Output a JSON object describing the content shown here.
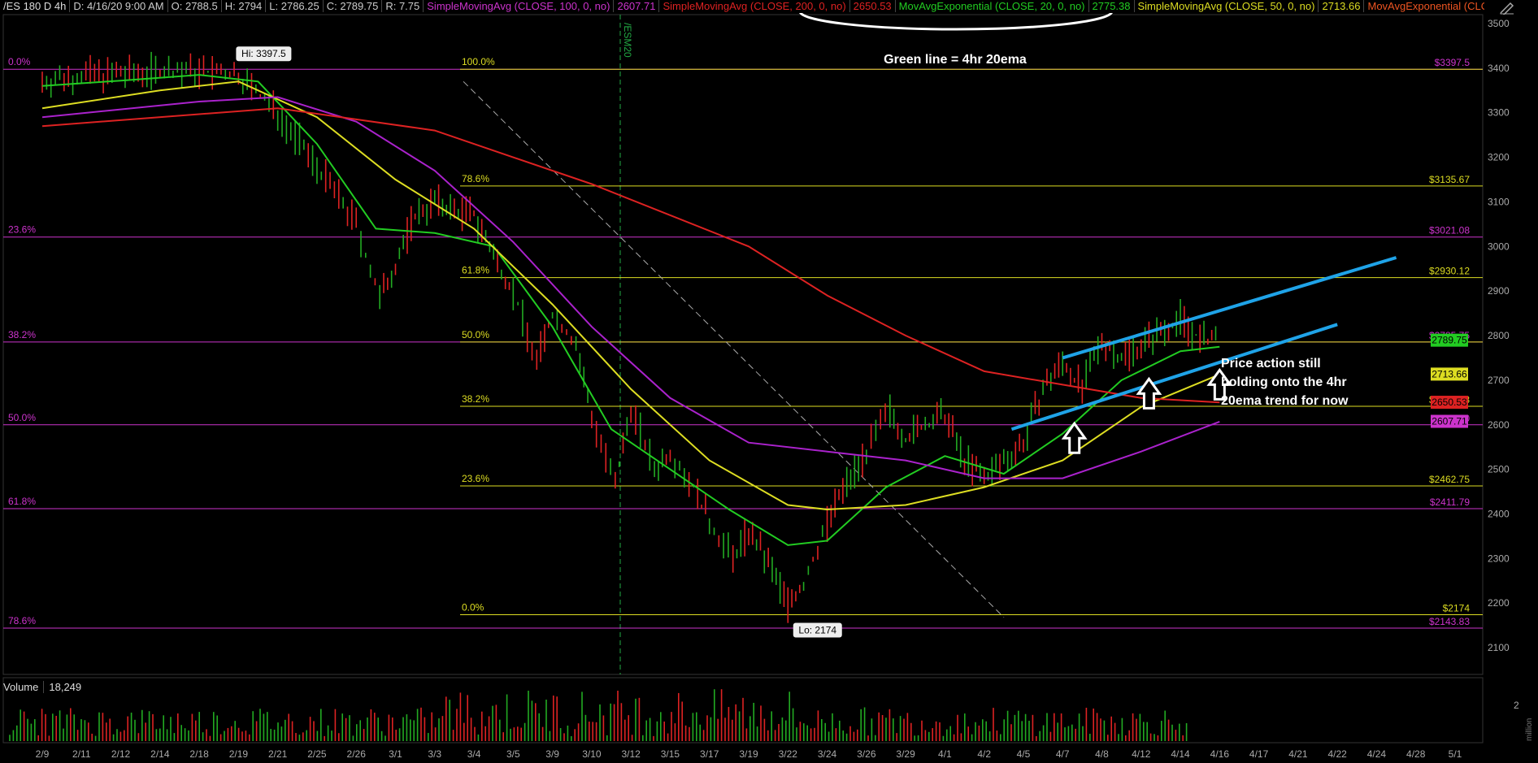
{
  "header": {
    "symbol": "/ES 180 D 4h",
    "datetime": "D: 4/16/20 9:00 AM",
    "open": "O: 2788.5",
    "high": "H: 2794",
    "low": "L: 2786.25",
    "close": "C: 2789.75",
    "range": "R: 7.75",
    "studies": [
      {
        "label": "SimpleMovingAvg (CLOSE, 100, 0, no)",
        "value": "2607.71",
        "color": "#cc33cc"
      },
      {
        "label": "SimpleMovingAvg (CLOSE, 200, 0, no)",
        "value": "2650.53",
        "color": "#dd2222"
      },
      {
        "label": "MovAvgExponential (CLOSE, 20, 0, no)",
        "value": "2775.38",
        "color": "#22cc22"
      },
      {
        "label": "SimpleMovingAvg (CLOSE, 50, 0, no)",
        "value": "2713.66",
        "color": "#dddd22"
      },
      {
        "label": "MovAvgExponential (CLOSE...",
        "value": "",
        "color": "#ee5522"
      }
    ]
  },
  "volume_panel": {
    "label": "Volume",
    "value": "18,249",
    "axis_tick": "2",
    "unit": "million"
  },
  "annotations": {
    "title": "Green line = 4hr 20ema",
    "note_lines": [
      "Price action still",
      "holding onto the 4hr",
      "20ema trend for now"
    ],
    "high_label": "Hi: 3397.5",
    "low_label": "Lo: 2174",
    "session_marker": "/ESM20"
  },
  "colors": {
    "background": "#000000",
    "fib_major": "#cc33cc",
    "fib_minor": "#dddd22",
    "ema20": "#22cc22",
    "sma50": "#dddd22",
    "sma100": "#aa22cc",
    "sma200": "#dd2222",
    "channel": "#1fa3e8",
    "candle_up": "#22aa22",
    "candle_down": "#dd2222"
  },
  "chart_data": {
    "type": "line",
    "title": "/ES 180 D 4h",
    "x_labels": [
      "2/9",
      "2/11",
      "2/12",
      "2/14",
      "2/18",
      "2/19",
      "2/21",
      "2/25",
      "2/26",
      "3/1",
      "3/3",
      "3/4",
      "3/5",
      "3/9",
      "3/10",
      "3/12",
      "3/15",
      "3/17",
      "3/19",
      "3/22",
      "3/24",
      "3/26",
      "3/29",
      "4/1",
      "4/2",
      "4/5",
      "4/7",
      "4/8",
      "4/12",
      "4/14",
      "4/16",
      "4/17",
      "4/21",
      "4/22",
      "4/24",
      "4/28",
      "5/1"
    ],
    "y_ticks": [
      2100,
      2200,
      2300,
      2400,
      2500,
      2600,
      2700,
      2800,
      2900,
      3000,
      3100,
      3200,
      3300,
      3400,
      3500
    ],
    "ylim": [
      2040,
      3520
    ],
    "price_path": [
      [
        0,
        3370
      ],
      [
        1,
        3385
      ],
      [
        2,
        3385
      ],
      [
        3,
        3395
      ],
      [
        4,
        3392
      ],
      [
        5,
        3385
      ],
      [
        6,
        3300
      ],
      [
        7,
        3180
      ],
      [
        8,
        3050
      ],
      [
        8.6,
        2880
      ],
      [
        9,
        2960
      ],
      [
        9.5,
        3070
      ],
      [
        10,
        3100
      ],
      [
        10.5,
        3080
      ],
      [
        11,
        3070
      ],
      [
        11.5,
        2980
      ],
      [
        12,
        2900
      ],
      [
        12.6,
        2740
      ],
      [
        13,
        2850
      ],
      [
        13.6,
        2780
      ],
      [
        14,
        2620
      ],
      [
        14.6,
        2460
      ],
      [
        15,
        2640
      ],
      [
        15.6,
        2500
      ],
      [
        16,
        2540
      ],
      [
        16.6,
        2460
      ],
      [
        17,
        2380
      ],
      [
        17.6,
        2300
      ],
      [
        18,
        2360
      ],
      [
        18.5,
        2290
      ],
      [
        19,
        2200
      ],
      [
        19.4,
        2240
      ],
      [
        20,
        2380
      ],
      [
        20.5,
        2470
      ],
      [
        21,
        2540
      ],
      [
        21.6,
        2630
      ],
      [
        22,
        2570
      ],
      [
        22.5,
        2600
      ],
      [
        23,
        2620
      ],
      [
        23.5,
        2520
      ],
      [
        24,
        2480
      ],
      [
        24.5,
        2520
      ],
      [
        25,
        2560
      ],
      [
        25.5,
        2680
      ],
      [
        26,
        2740
      ],
      [
        26.5,
        2680
      ],
      [
        27,
        2790
      ],
      [
        27.5,
        2750
      ],
      [
        28,
        2780
      ],
      [
        28.5,
        2810
      ],
      [
        29,
        2840
      ],
      [
        29.5,
        2790
      ],
      [
        30,
        2789.75
      ]
    ],
    "series": [
      {
        "name": "MovAvgExponential 20",
        "values": [
          [
            0,
            3360
          ],
          [
            2,
            3372
          ],
          [
            4,
            3385
          ],
          [
            5.5,
            3370
          ],
          [
            7,
            3230
          ],
          [
            8.5,
            3040
          ],
          [
            10,
            3030
          ],
          [
            11.5,
            3000
          ],
          [
            13,
            2820
          ],
          [
            14.5,
            2590
          ],
          [
            16,
            2500
          ],
          [
            17.5,
            2410
          ],
          [
            19,
            2330
          ],
          [
            20,
            2340
          ],
          [
            21.5,
            2460
          ],
          [
            23,
            2530
          ],
          [
            24.5,
            2490
          ],
          [
            26,
            2580
          ],
          [
            27.5,
            2700
          ],
          [
            29,
            2765
          ],
          [
            30,
            2775
          ]
        ]
      },
      {
        "name": "SimpleMovingAvg 50",
        "values": [
          [
            0,
            3310
          ],
          [
            3,
            3350
          ],
          [
            5,
            3370
          ],
          [
            7,
            3290
          ],
          [
            9,
            3150
          ],
          [
            11,
            3040
          ],
          [
            13,
            2870
          ],
          [
            15,
            2680
          ],
          [
            17,
            2520
          ],
          [
            19,
            2420
          ],
          [
            20,
            2410
          ],
          [
            22,
            2420
          ],
          [
            24,
            2460
          ],
          [
            26,
            2520
          ],
          [
            28,
            2640
          ],
          [
            30,
            2713
          ]
        ]
      },
      {
        "name": "SimpleMovingAvg 100",
        "values": [
          [
            0,
            3290
          ],
          [
            4,
            3325
          ],
          [
            6,
            3335
          ],
          [
            8,
            3280
          ],
          [
            10,
            3170
          ],
          [
            12,
            3010
          ],
          [
            14,
            2820
          ],
          [
            16,
            2660
          ],
          [
            18,
            2560
          ],
          [
            20,
            2540
          ],
          [
            22,
            2520
          ],
          [
            24,
            2480
          ],
          [
            26,
            2480
          ],
          [
            28,
            2540
          ],
          [
            30,
            2607
          ]
        ]
      },
      {
        "name": "SimpleMovingAvg 200",
        "values": [
          [
            0,
            3270
          ],
          [
            6,
            3310
          ],
          [
            10,
            3260
          ],
          [
            14,
            3140
          ],
          [
            18,
            3000
          ],
          [
            20,
            2890
          ],
          [
            22,
            2800
          ],
          [
            24,
            2720
          ],
          [
            26,
            2690
          ],
          [
            28,
            2660
          ],
          [
            30,
            2650
          ]
        ]
      }
    ],
    "fib_levels_major": [
      {
        "pct": "0.0%",
        "price": 3397.5
      },
      {
        "pct": "23.6%",
        "price": 3021.08
      },
      {
        "pct": "38.2%",
        "price": 2785.75
      },
      {
        "pct": "50.0%",
        "price": 2600
      },
      {
        "pct": "61.8%",
        "price": 2411.79
      },
      {
        "pct": "78.6%",
        "price": 2143.83
      }
    ],
    "fib_levels_minor": [
      {
        "pct": "100.0%",
        "price": 3397.5
      },
      {
        "pct": "78.6%",
        "price": 3135.67
      },
      {
        "pct": "61.8%",
        "price": 2930.12
      },
      {
        "pct": "50.0%",
        "price": 2785.75
      },
      {
        "pct": "38.2%",
        "price": 2641.38
      },
      {
        "pct": "23.6%",
        "price": 2462.75
      },
      {
        "pct": "0.0%",
        "price": 2174
      }
    ],
    "right_labels_major": [
      "$3397.5",
      "$3021.08",
      "$2785.75",
      "$2600",
      "$2411.79",
      "$2143.83"
    ],
    "right_labels_minor": [
      "$3135.67",
      "$2930.12",
      "$2641.38",
      "$2462.75",
      "$2174"
    ],
    "price_badges": [
      {
        "text": "2789.75",
        "price": 2789.75,
        "bg": "#22cc22"
      },
      {
        "text": "2713.66",
        "price": 2713.66,
        "bg": "#dddd22"
      },
      {
        "text": "2650.53",
        "price": 2650.53,
        "bg": "#dd2222"
      },
      {
        "text": "2607.71",
        "price": 2607.71,
        "bg": "#cc33cc"
      }
    ],
    "channel_lines": [
      [
        [
          26,
          2750
        ],
        [
          34.5,
          2975
        ]
      ],
      [
        [
          24.7,
          2590
        ],
        [
          33,
          2825
        ]
      ]
    ],
    "arrows": [
      [
        26.3,
        2570
      ],
      [
        28.2,
        2670
      ],
      [
        30,
        2690
      ]
    ],
    "high_point": [
      5,
      3397.5
    ],
    "low_point": [
      19.3,
      2174
    ]
  }
}
